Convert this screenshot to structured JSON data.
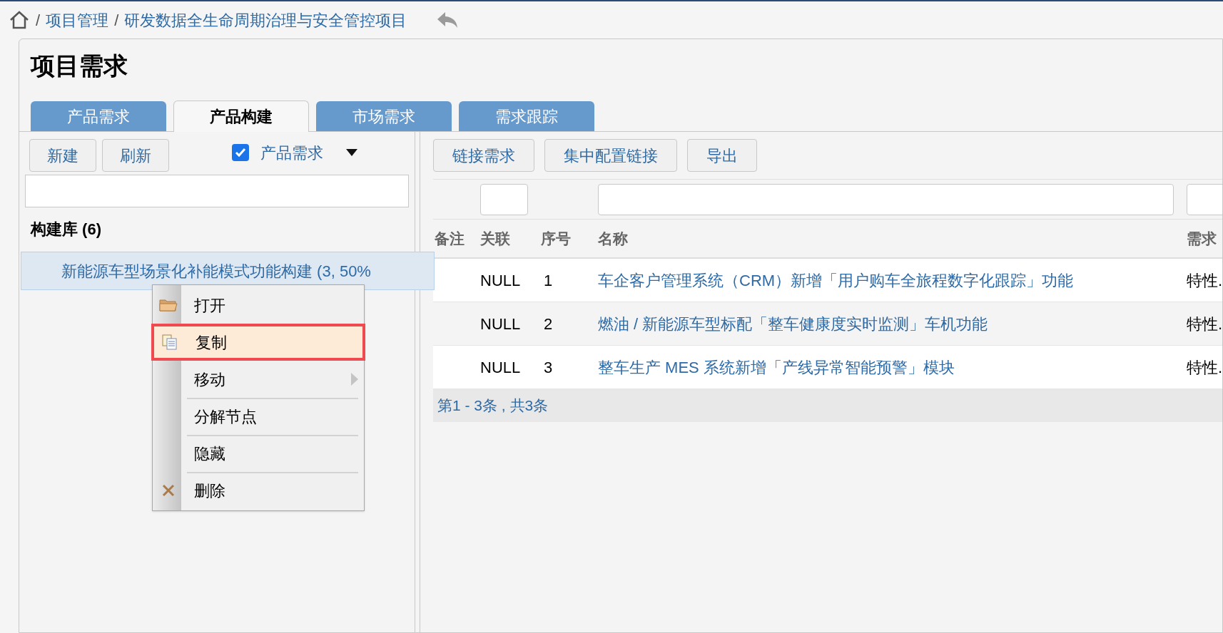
{
  "breadcrumb": {
    "separator": "/",
    "items": [
      "项目管理",
      "研发数据全生命周期治理与安全管控项目"
    ]
  },
  "page_title": "项目需求",
  "tabs": [
    {
      "label": "产品需求",
      "selected": false
    },
    {
      "label": "产品构建",
      "selected": true
    },
    {
      "label": "市场需求",
      "selected": false
    },
    {
      "label": "需求跟踪",
      "selected": false
    }
  ],
  "left_panel": {
    "buttons": [
      "新建",
      "刷新"
    ],
    "filter": {
      "label": "产品需求",
      "checked": true
    },
    "tree": {
      "label": "构建库 (6)",
      "children": [
        {
          "label": "新能源车型场景化补能模式功能构建 (3, 50%",
          "selected": true
        }
      ]
    }
  },
  "context_menu": [
    {
      "label": "打开",
      "kind": "folder",
      "selected": false,
      "submenu": false
    },
    {
      "label": "复制",
      "kind": "copy",
      "selected": true,
      "submenu": false
    },
    {
      "label": "移动",
      "kind": "plain",
      "selected": false,
      "submenu": true
    },
    {
      "label": "分解节点",
      "kind": "plain",
      "selected": false,
      "submenu": false
    },
    {
      "label": "隐藏",
      "kind": "plain",
      "selected": false,
      "submenu": false
    },
    {
      "label": "删除",
      "kind": "delete",
      "selected": false,
      "submenu": false
    }
  ],
  "right_panel": {
    "buttons": [
      "链接需求",
      "集中配置链接",
      "导出"
    ],
    "table": {
      "columns": [
        {
          "label": "备注",
          "filter": false
        },
        {
          "label": "关联",
          "filter": true
        },
        {
          "label": "序号",
          "filter": false
        },
        {
          "label": "名称",
          "filter": true
        },
        {
          "label": "需求",
          "filter": true
        }
      ],
      "rows": [
        {
          "link": "NULL",
          "index": "1",
          "name": "车企客户管理系统（CRM）新增「用户购车全旅程数字化跟踪」功能",
          "requirement": "特性."
        },
        {
          "link": "NULL",
          "index": "2",
          "name": "燃油 / 新能源车型标配「整车健康度实时监测」车机功能",
          "requirement": "特性."
        },
        {
          "link": "NULL",
          "index": "3",
          "name": "整车生产 MES 系统新增「产线异常智能预警」模块",
          "requirement": "特性."
        }
      ],
      "pagination": "第1 - 3条 , 共3条"
    }
  }
}
